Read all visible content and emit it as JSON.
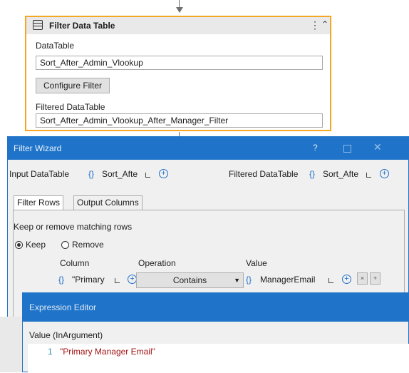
{
  "activity": {
    "title": "Filter Data Table",
    "datatable_label": "DataTable",
    "datatable_value": "Sort_After_Admin_Vlookup",
    "configure_button": "Configure Filter",
    "filtered_label": "Filtered DataTable",
    "filtered_value": "Sort_After_Admin_Vlookup_After_Manager_Filter"
  },
  "wizard": {
    "title": "Filter Wizard",
    "help": "?",
    "close": "✕",
    "input_label": "Input DataTable",
    "input_value": "Sort_Afte",
    "output_label": "Filtered DataTable",
    "output_value": "Sort_Afte",
    "tabs": [
      "Filter Rows",
      "Output Columns"
    ],
    "keep_remove_label": "Keep or remove matching rows",
    "keep_label": "Keep",
    "remove_label": "Remove",
    "column_header": "Column",
    "operation_header": "Operation",
    "value_header": "Value",
    "row": {
      "column": "\"Primary",
      "operation": "Contains",
      "value": "ManagerEmail"
    },
    "curly": "{}",
    "remove_row": "×",
    "add_row": "+"
  },
  "expression_editor": {
    "title": "Expression Editor",
    "value_label": "Value (InArgument)",
    "line_number": "1",
    "code": "\"Primary Manager Email\""
  },
  "colors": {
    "accent": "#1f74c9",
    "selection_border": "#f5a623",
    "code_string": "#a31515"
  }
}
